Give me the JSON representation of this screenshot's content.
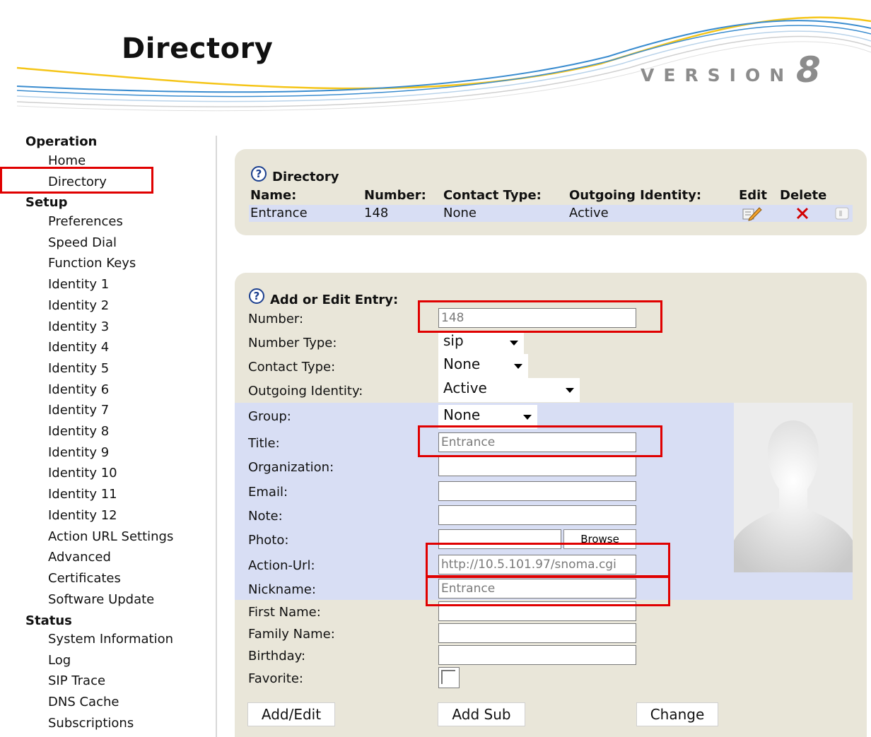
{
  "header": {
    "title": "Directory",
    "version_label": "VERSION",
    "version_number": "8"
  },
  "sidebar": {
    "operation": {
      "title": "Operation",
      "items": [
        "Home",
        "Directory"
      ]
    },
    "setup": {
      "title": "Setup",
      "items": [
        "Preferences",
        "Speed Dial",
        "Function Keys",
        "Identity 1",
        "Identity 2",
        "Identity 3",
        "Identity 4",
        "Identity 5",
        "Identity 6",
        "Identity 7",
        "Identity 8",
        "Identity 9",
        "Identity 10",
        "Identity 11",
        "Identity 12",
        "Action URL Settings",
        "Advanced",
        "Certificates",
        "Software Update"
      ]
    },
    "status": {
      "title": "Status",
      "items": [
        "System Information",
        "Log",
        "SIP Trace",
        "DNS Cache",
        "Subscriptions"
      ]
    }
  },
  "directory": {
    "help_icon": "?",
    "title": "Directory",
    "columns": [
      "Name:",
      "Number:",
      "Contact Type:",
      "Outgoing Identity:",
      "Edit",
      "Delete"
    ],
    "rows": [
      {
        "name": "Entrance",
        "number": "148",
        "contact_type": "None",
        "outgoing_identity": "Active"
      }
    ],
    "icons": {
      "edit": "pencil-icon",
      "delete": "x-icon",
      "extra": "speaker-icon"
    }
  },
  "entry": {
    "help_icon": "?",
    "title": "Add or Edit Entry:",
    "labels": {
      "number": "Number:",
      "number_type": "Number Type:",
      "contact_type": "Contact Type:",
      "outgoing_identity": "Outgoing Identity:",
      "group": "Group:",
      "title": "Title:",
      "organization": "Organization:",
      "email": "Email:",
      "note": "Note:",
      "photo": "Photo:",
      "action_url": "Action-Url:",
      "nickname": "Nickname:",
      "first_name": "First Name:",
      "family_name": "Family Name:",
      "birthday": "Birthday:",
      "favorite": "Favorite:"
    },
    "values": {
      "number": "148",
      "number_type": "sip",
      "contact_type": "None",
      "outgoing_identity": "Active",
      "group": "None",
      "title": "Entrance",
      "organization": "",
      "email": "",
      "note": "",
      "photo": "",
      "action_url": "http://10.5.101.97/snoma.cgi",
      "nickname": "Entrance",
      "first_name": "",
      "family_name": "",
      "birthday": ""
    },
    "favorite_checked": false,
    "browse_label": "Browse",
    "photo_placeholder": "avatar-silhouette-icon",
    "buttons": {
      "add_edit": "Add/Edit",
      "add_sub": "Add Sub",
      "change": "Change"
    }
  },
  "colors": {
    "highlight_box": "#e00000",
    "panel": "#e9e6d9",
    "row_highlight": "#d8def4",
    "swoosh_yellow": "#f5c518",
    "swoosh_blue": "#3a8ccf"
  }
}
